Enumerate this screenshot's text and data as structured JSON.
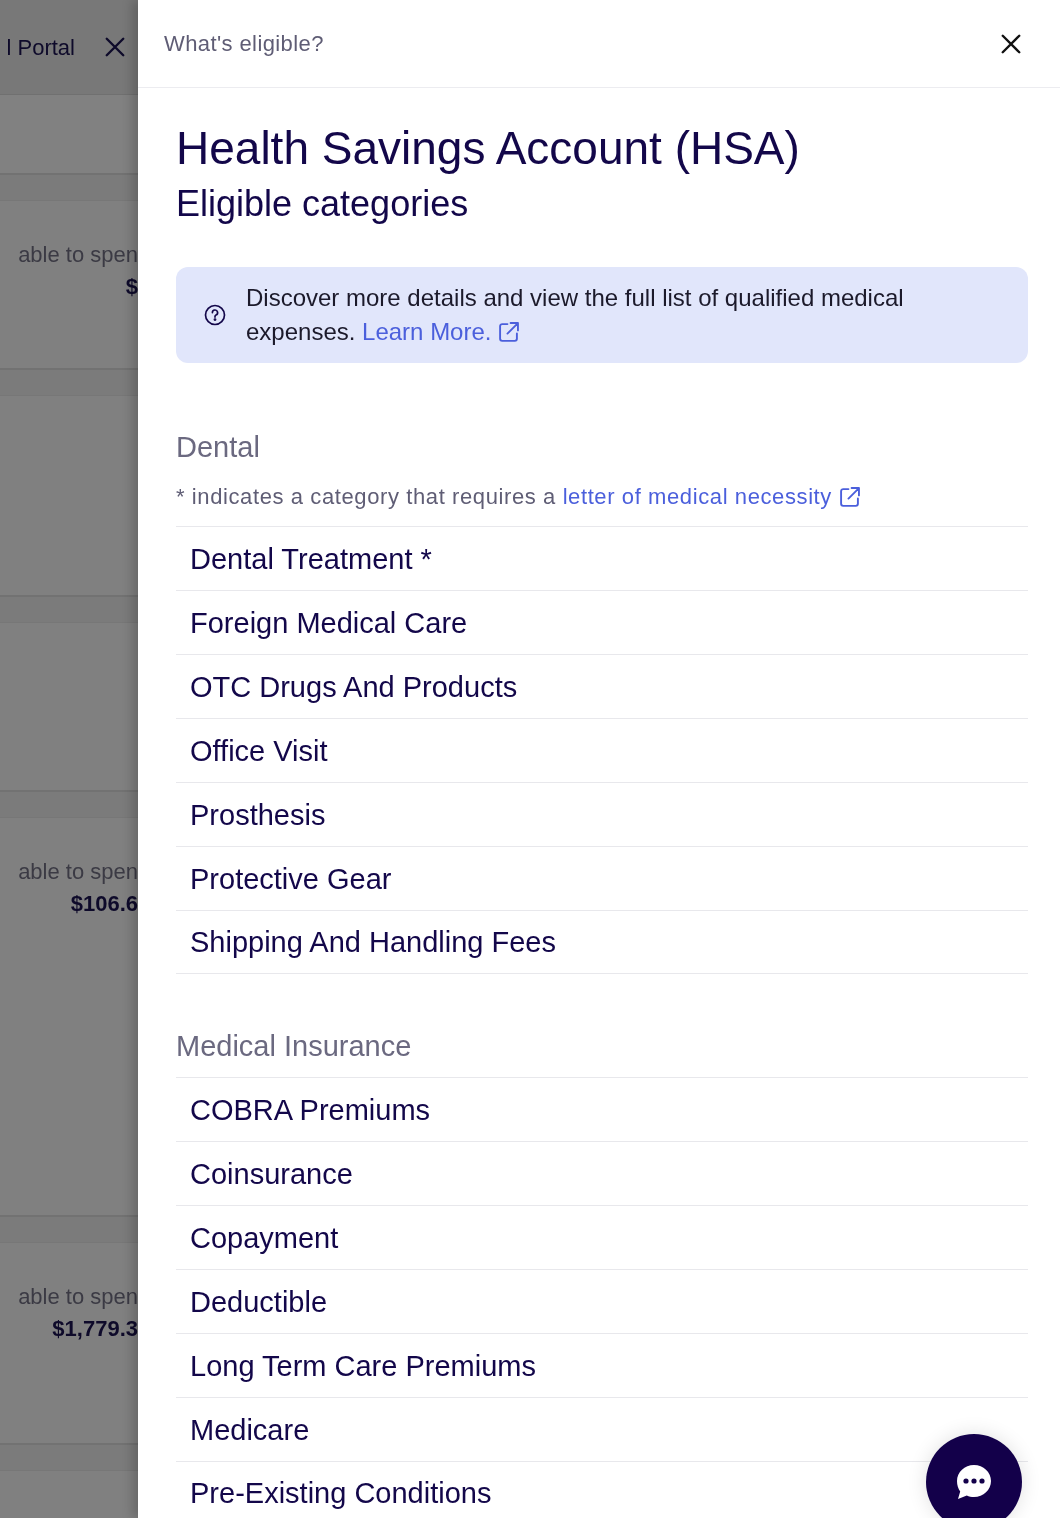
{
  "background_page": {
    "header_title": "l Portal",
    "cards": [
      {
        "label": "able to spen",
        "amount": "$"
      },
      {
        "label": "able to spen",
        "amount": "$106.6"
      },
      {
        "label": "able to spen",
        "amount": "$1,779.3"
      }
    ]
  },
  "drawer": {
    "title": "What's eligible?",
    "heading": "Health Savings Account (HSA)",
    "subheading": "Eligible categories",
    "info": {
      "text": "Discover more details and view the full list of qualified medical expenses.",
      "link": "Learn More."
    },
    "sections": [
      {
        "title": "Dental",
        "note": {
          "text": "* indicates a category that requires a",
          "link": "letter of medical necessity"
        },
        "items": [
          "Dental Treatment *",
          "Foreign Medical Care",
          "OTC Drugs And Products",
          "Office Visit",
          "Prosthesis",
          "Protective Gear",
          "Shipping And Handling Fees"
        ]
      },
      {
        "title": "Medical Insurance",
        "items": [
          "COBRA Premiums",
          "Coinsurance",
          "Copayment",
          "Deductible",
          "Long Term Care Premiums",
          "Medicare",
          "Pre-Existing Conditions"
        ]
      }
    ]
  }
}
